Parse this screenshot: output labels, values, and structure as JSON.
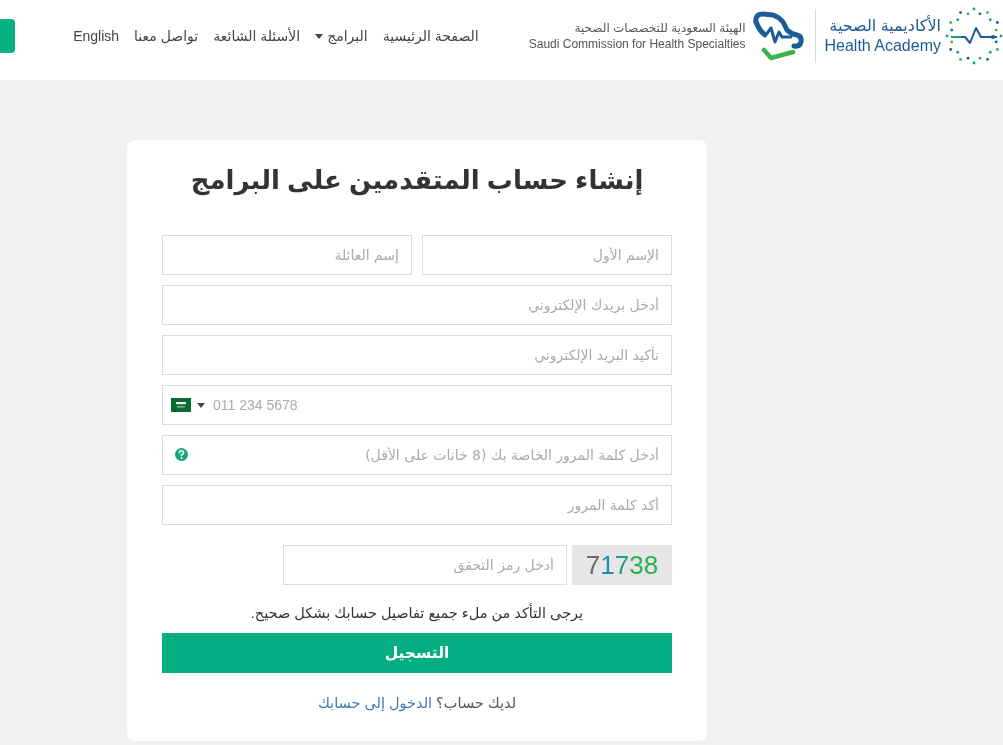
{
  "header": {
    "brand": {
      "name_ar": "الأكاديمية الصحية",
      "name_en": "Health Academy"
    },
    "commission": {
      "name_ar": "الهيئة السعودية للتخصصات الصحية",
      "name_en": "Saudi Commission for Health Specialties"
    },
    "nav": [
      {
        "label": "الصفحة الرئيسية",
        "dropdown": false
      },
      {
        "label": "البرامج",
        "dropdown": true
      },
      {
        "label": "الأسئلة الشائعة",
        "dropdown": false
      },
      {
        "label": "تواصل معنا",
        "dropdown": false
      },
      {
        "label": "English",
        "dropdown": false
      }
    ]
  },
  "form": {
    "title": "إنشاء حساب المتقدمين على البرامج",
    "rows": [
      [
        {
          "kind": "text",
          "placeholder": "الإسم الأول"
        },
        {
          "kind": "text",
          "placeholder": "إسم العائلة"
        }
      ],
      [
        {
          "kind": "text",
          "placeholder": "أدخل بريدك الإلكتروني"
        }
      ],
      [
        {
          "kind": "text",
          "placeholder": "تأكيد البريد الإلكتروني"
        }
      ],
      [
        {
          "kind": "phone",
          "placeholder": "011 234 5678"
        }
      ],
      [
        {
          "kind": "help",
          "placeholder": "أدخل كلمة المرور الخاصة بك (8 خانات على الأقل)"
        }
      ],
      [
        {
          "kind": "text",
          "placeholder": "أكد كلمة المرور"
        }
      ]
    ],
    "captcha": {
      "placeholder": "أدخل رمز التحقق",
      "code": "71738"
    },
    "notice": "يرجى التأكد من ملء جميع تفاصيل حسابك بشكل صحيح.",
    "submit": "التسجيل",
    "login_prompt": {
      "text": "لديك حساب؟",
      "link": "الدخول إلى حسابك"
    }
  }
}
